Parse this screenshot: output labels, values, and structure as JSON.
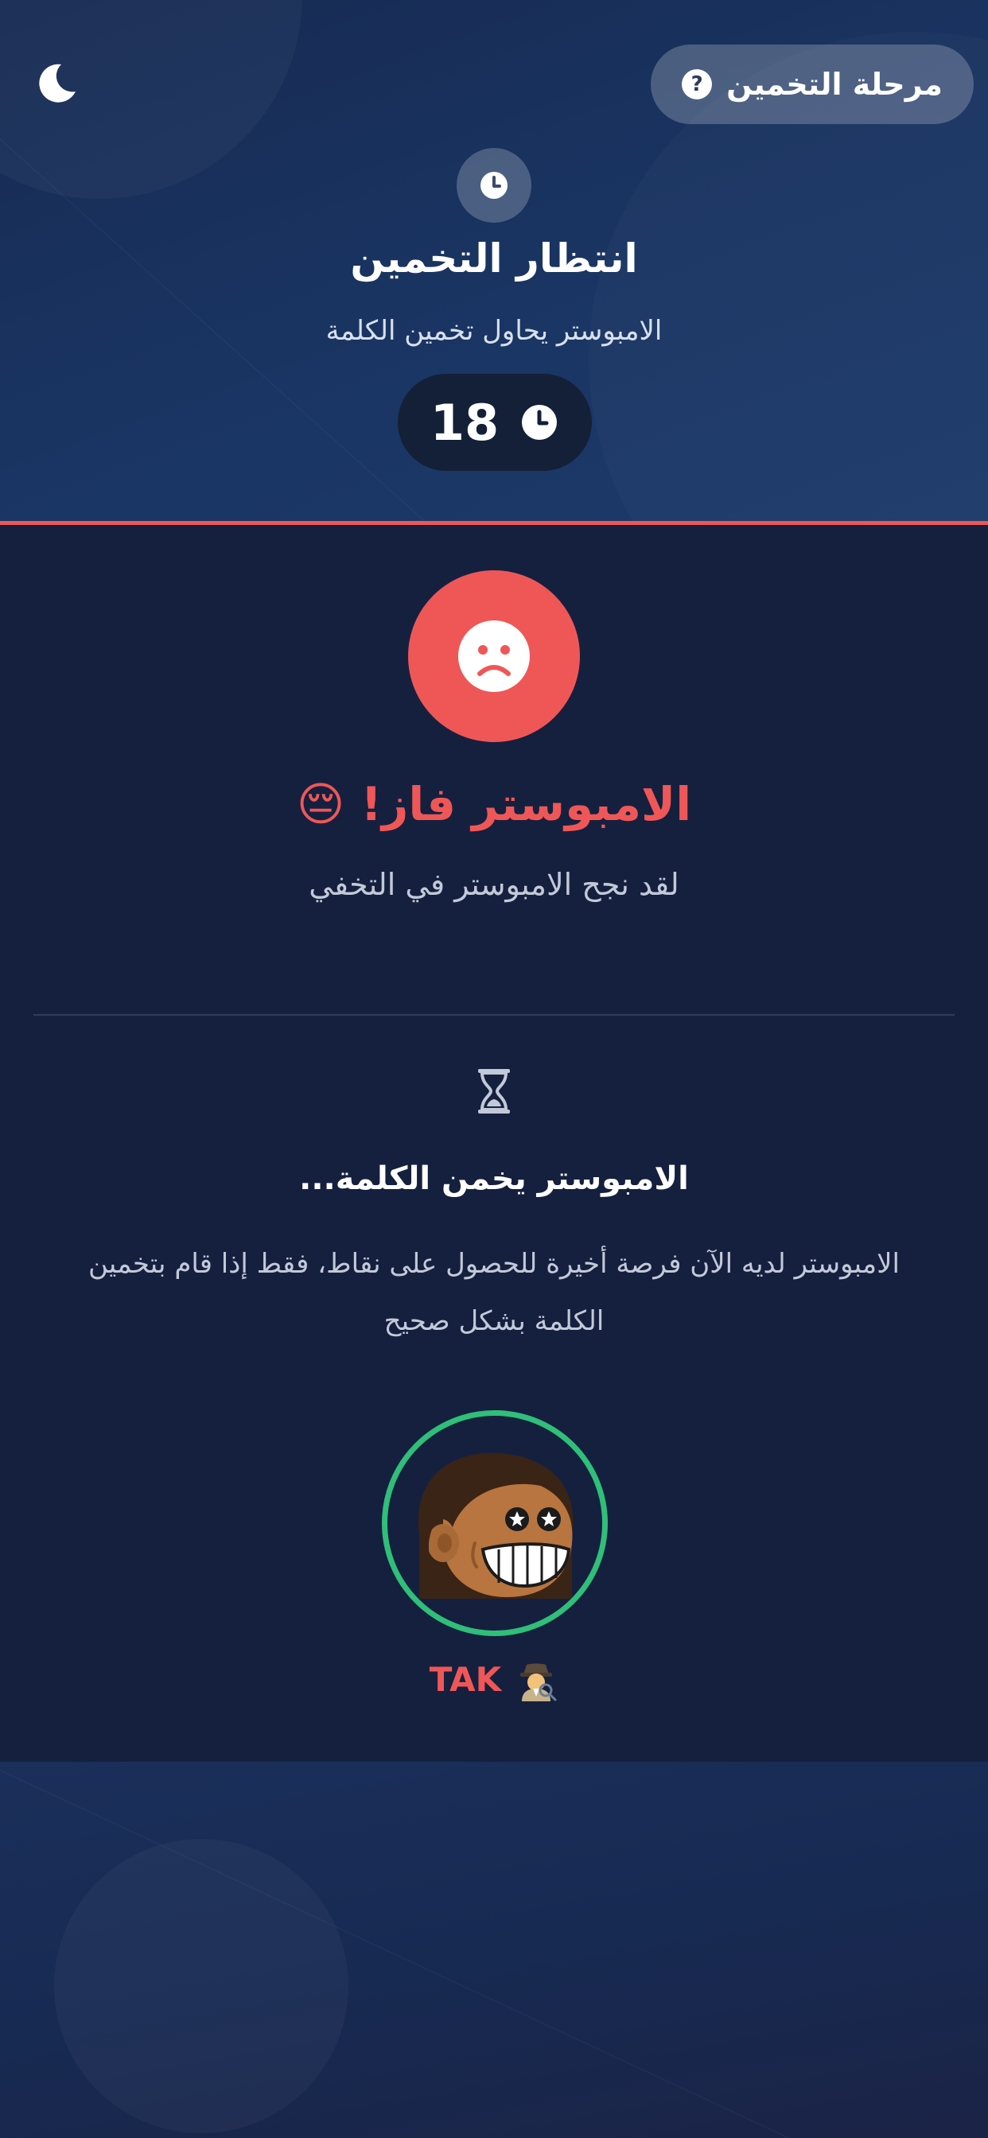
{
  "header": {
    "phase_label": "مرحلة التخمين",
    "phase_icon": "question-icon",
    "title": "انتظار التخمين",
    "subtitle": "الامبوستر يحاول تخمين الكلمة",
    "timer": "18",
    "accent_color": "#ef5757"
  },
  "result": {
    "title": "الامبوستر فاز! 😔",
    "subtitle": "لقد نجح الامبوستر في التخفي",
    "icon": "sad-face-icon"
  },
  "guessing": {
    "title": "الامبوستر يخمن الكلمة...",
    "description": "الامبوستر لديه الآن فرصة أخيرة للحصول على نقاط، فقط إذا قام بتخمين الكلمة بشكل صحيح",
    "icon": "hourglass-icon"
  },
  "player": {
    "name": "TAK",
    "role_icon": "detective-icon",
    "ring_color": "#2fbf78"
  }
}
